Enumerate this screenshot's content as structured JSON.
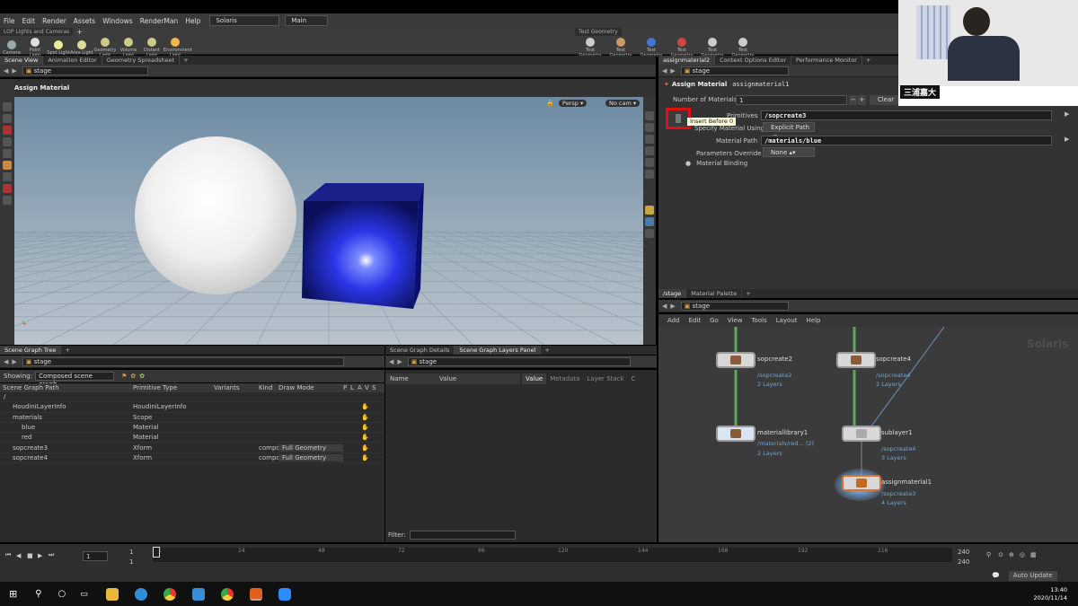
{
  "menu": {
    "items": [
      "File",
      "Edit",
      "Render",
      "Assets",
      "Windows",
      "RenderMan",
      "Help"
    ],
    "desktop": "Solaris",
    "context": "Main"
  },
  "shelf": {
    "tab_left": "LOP Lights and Cameras",
    "tools_left": [
      "Camera",
      "Point Light",
      "Spot Light",
      "Area Light",
      "Geometry Light",
      "Volume Light",
      "Distant Light",
      "Environment Light"
    ],
    "tab_right": "Test Geometry",
    "tools_right": [
      "Test Geometry",
      "Test Geometry",
      "Test Geometry",
      "Test Geometry",
      "Test Geometry",
      "Test Geometry"
    ]
  },
  "viewer": {
    "tabs": [
      "Scene View",
      "Animation Editor",
      "Geometry Spreadsheet"
    ],
    "path": "stage",
    "node_label": "Assign Material",
    "persp_label": "Persp",
    "cam_label": "No cam"
  },
  "params": {
    "tabs": [
      "assignmaterial2",
      "Context Options Editor",
      "Performance Monitor"
    ],
    "path": "stage",
    "node_type": "Assign Material",
    "node_name": "assignmaterial1",
    "num_materials_label": "Number of Materials",
    "num_materials_value": "1",
    "clear_label": "Clear",
    "tooltip": "Insert Before 0",
    "primitives_label": "Primitives",
    "primitives_value": "/sopcreate3",
    "specify_label": "Specify Material Using",
    "specify_value": "Explicit Path",
    "material_path_label": "Material Path",
    "material_path_value": "/materials/blue",
    "params_override_label": "Parameters Override",
    "params_override_value": "None",
    "binding_label": "Material Binding"
  },
  "webcam": {
    "name": "三浦嘉大"
  },
  "scene_graph": {
    "tabs": [
      "Scene Graph Tree"
    ],
    "path": "stage",
    "showing_label": "Showing:",
    "showing_value": "Composed scene graph",
    "columns": [
      "Scene Graph Path",
      "Primitive Type",
      "Variants",
      "Kind",
      "Draw Mode",
      "P",
      "L",
      "A",
      "V",
      "S"
    ],
    "rows": [
      {
        "path": "/",
        "type": "",
        "kind": "",
        "draw": ""
      },
      {
        "path": "HoudiniLayerInfo",
        "type": "HoudiniLayerInfo",
        "kind": "",
        "draw": ""
      },
      {
        "path": "materials",
        "type": "Scope",
        "kind": "",
        "draw": ""
      },
      {
        "path": "blue",
        "type": "Material",
        "kind": "",
        "draw": ""
      },
      {
        "path": "red",
        "type": "Material",
        "kind": "",
        "draw": ""
      },
      {
        "path": "sopcreate3",
        "type": "Xform",
        "kind": "compo",
        "draw": "Full Geometry"
      },
      {
        "path": "sopcreate4",
        "type": "Xform",
        "kind": "compo",
        "draw": "Full Geometry"
      }
    ]
  },
  "details": {
    "tabs": [
      "Scene Graph Details",
      "Scene Graph Layers Panel"
    ],
    "path": "stage",
    "col_name": "Name",
    "col_value": "Value",
    "sub_tabs": [
      "Value",
      "Metadata",
      "Layer Stack",
      "C"
    ],
    "filter_label": "Filter:"
  },
  "network": {
    "tabs": [
      "/stage",
      "Material Palette"
    ],
    "path": "stage",
    "menu": [
      "Add",
      "Edit",
      "Go",
      "View",
      "Tools",
      "Layout",
      "Help"
    ],
    "context_label": "Solaris",
    "nodes": [
      {
        "name": "sopcreate2",
        "sub1": "/sopcreate2",
        "sub2": "2 Layers"
      },
      {
        "name": "sopcreate4",
        "sub1": "/sopcreate4",
        "sub2": "2 Layers"
      },
      {
        "name": "materiallibrary1",
        "sub1": "/materials/red... (2)",
        "sub2": "2 Layers"
      },
      {
        "name": "sublayer1",
        "sub1": "/sopcreate4",
        "sub2": "3 Layers"
      },
      {
        "name": "assignmaterial1",
        "sub1": "/sopcreate3",
        "sub2": "4 Layers"
      }
    ]
  },
  "timeline": {
    "frame": "1",
    "start_a": "1",
    "start_b": "1",
    "ticks": [
      "1",
      "24",
      "48",
      "72",
      "96",
      "120",
      "144",
      "168",
      "192",
      "216"
    ],
    "end_a": "240",
    "end_b": "240",
    "auto_update": "Auto Update"
  },
  "taskbar": {
    "time": "13:40",
    "date": "2020/11/14"
  }
}
